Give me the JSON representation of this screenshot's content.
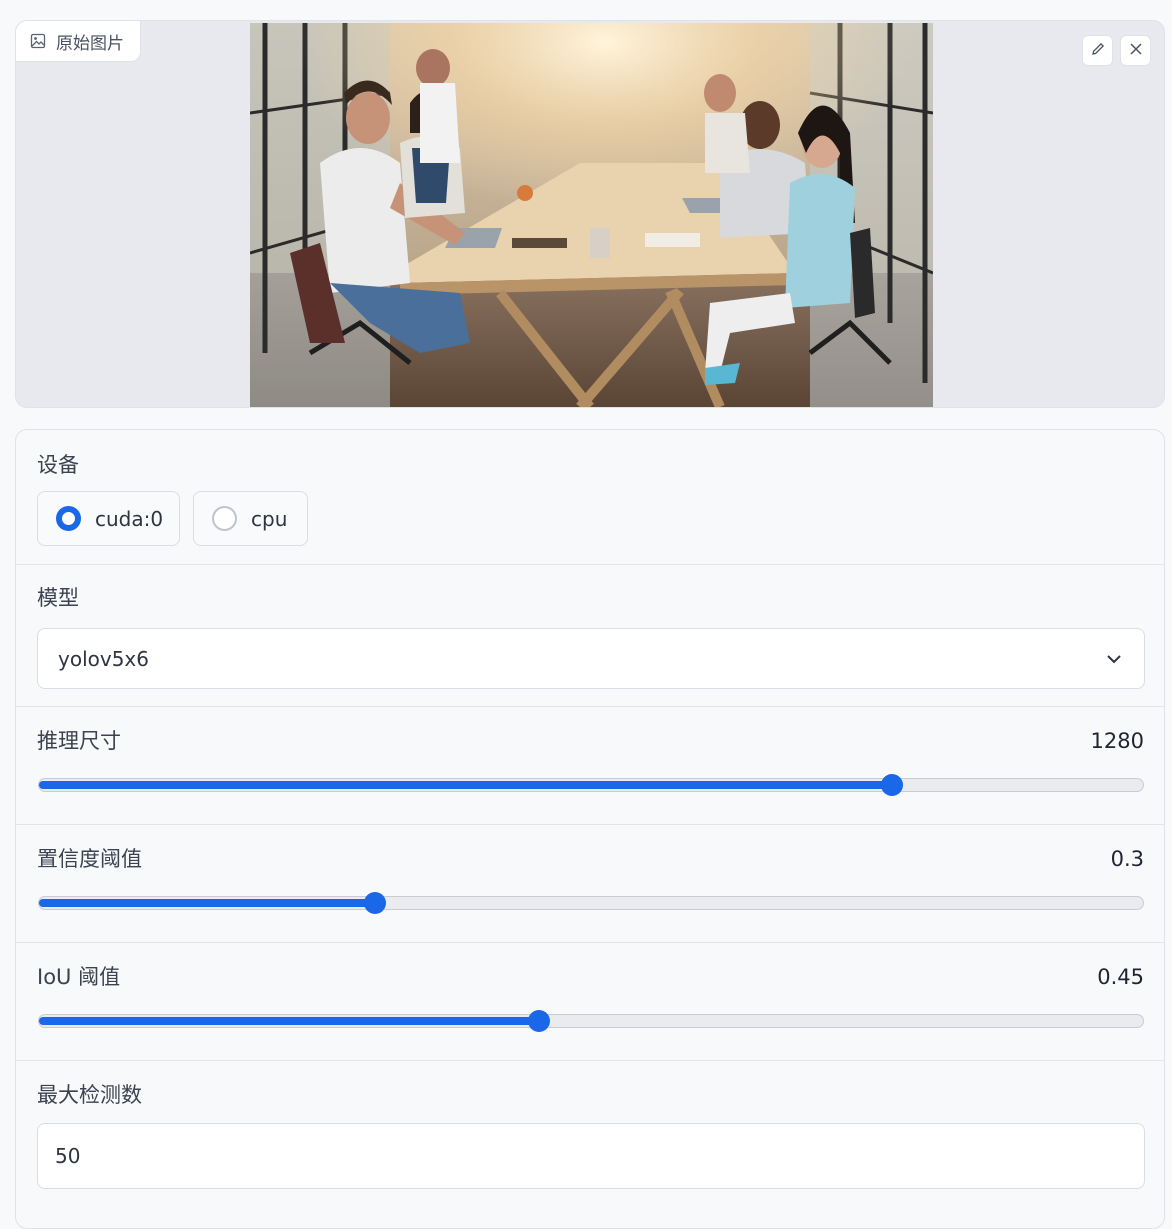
{
  "image_panel": {
    "label": "原始图片",
    "label_icon": "image-icon",
    "actions": [
      {
        "icon": "pencil-icon"
      },
      {
        "icon": "close-icon"
      }
    ]
  },
  "device": {
    "label": "设备",
    "options": [
      "cuda:0",
      "cpu"
    ],
    "selected": "cuda:0"
  },
  "model": {
    "label": "模型",
    "value": "yolov5x6",
    "icon": "chevron-down-icon"
  },
  "inference_size": {
    "label": "推理尺寸",
    "value": "1280",
    "fraction": 0.773
  },
  "confidence": {
    "label": "置信度阈值",
    "value": "0.3",
    "fraction": 0.304
  },
  "iou": {
    "label": "IoU 阈值",
    "value": "0.45",
    "fraction": 0.453
  },
  "max_det": {
    "label": "最大检测数",
    "value": "50"
  },
  "colors": {
    "accent": "#1a67e8",
    "panel_bg": "#e7e9ee",
    "border": "#dfe2e8"
  }
}
